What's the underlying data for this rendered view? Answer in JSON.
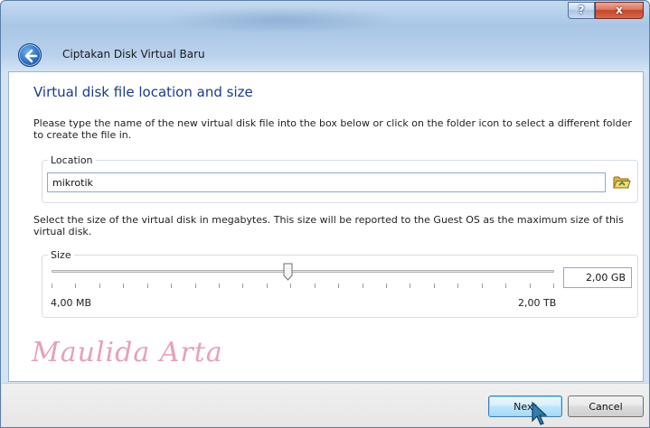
{
  "window": {
    "title": "Ciptakan Disk Virtual Baru",
    "help_label": "?",
    "close_label": "x"
  },
  "page": {
    "title": "Virtual disk file location and size"
  },
  "location": {
    "description": "Please type the name of the new virtual disk file into the box below or click on the folder icon to select a different folder to create the file in.",
    "group_label": "Location",
    "value": "mikrotik",
    "folder_icon": "folder-icon"
  },
  "size": {
    "description": "Select the size of the virtual disk in megabytes. This size will be reported to the Guest OS as the maximum size of this virtual disk.",
    "group_label": "Size",
    "value": "2,00 GB",
    "min_label": "4,00 MB",
    "max_label": "2,00 TB",
    "slider_position": 0.47
  },
  "watermark": "Maulida Arta",
  "footer": {
    "next_label": "Next",
    "cancel_label": "Cancel"
  },
  "colors": {
    "title_blue": "#1a3a8c",
    "watermark_pink": "#e7a0ba",
    "close_red": "#c5452a"
  }
}
